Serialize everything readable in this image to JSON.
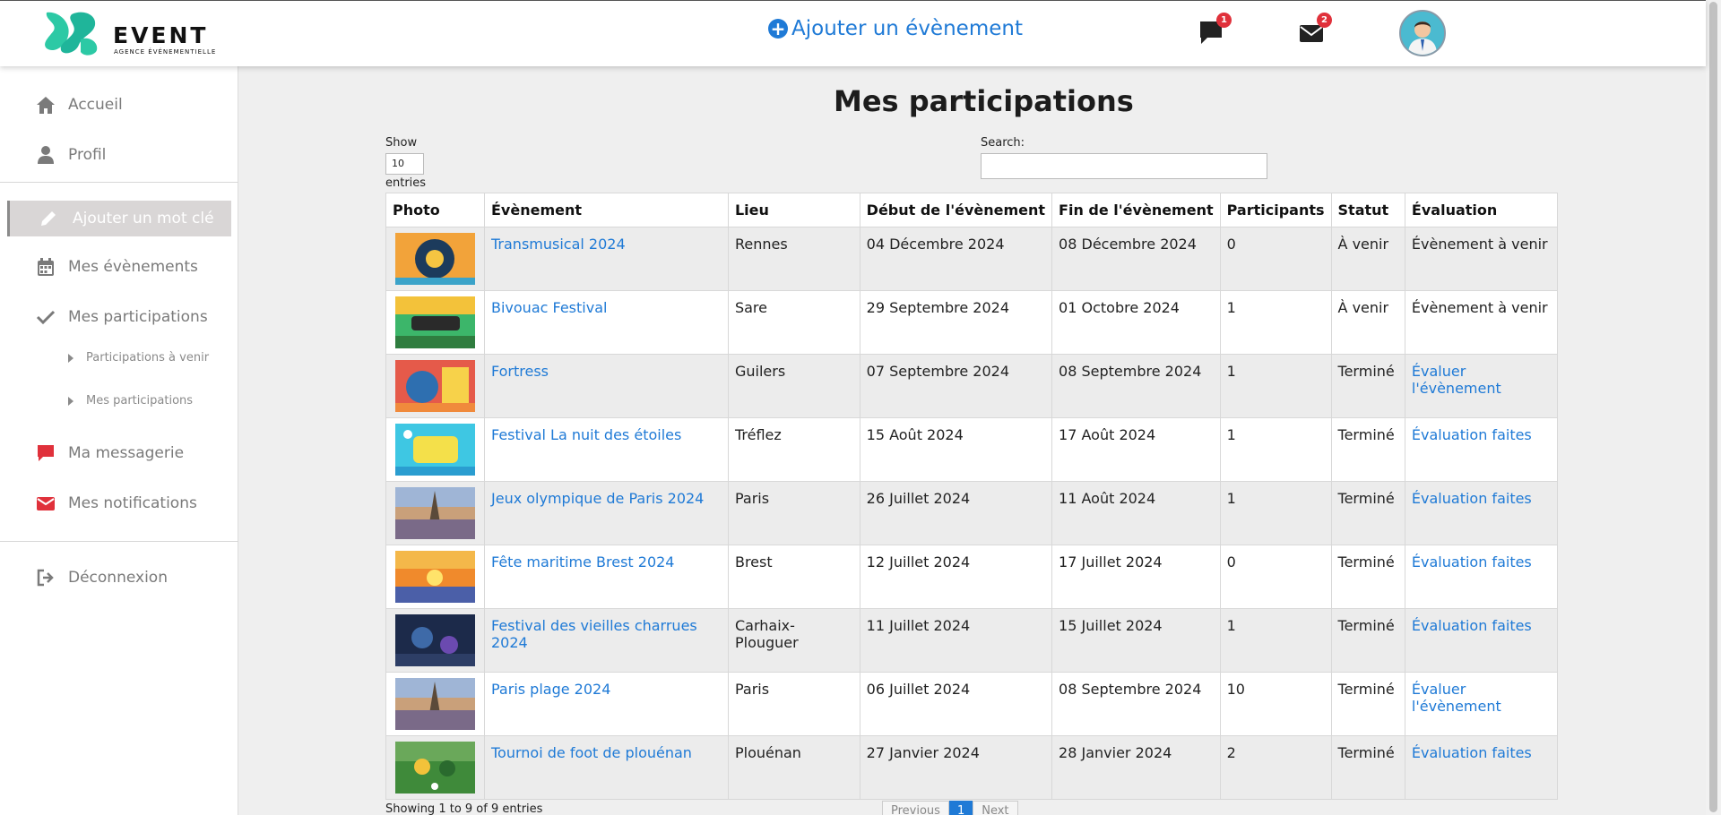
{
  "header": {
    "logo_title": "EVENT",
    "logo_subtitle": "AGENCE ÉVÉNEMENTIELLE",
    "add_event_label": "Ajouter un évènement",
    "chat_badge": "1",
    "mail_badge": "2",
    "colors": {
      "accent": "#1f7ad6",
      "badge": "#e0313b",
      "logo": "#2cc9a5"
    }
  },
  "sidebar": {
    "home": "Accueil",
    "profile": "Profil",
    "add_keyword": "Ajouter un mot clé",
    "my_events": "Mes évènements",
    "my_participations": "Mes participations",
    "sub_upcoming": "Participations à venir",
    "sub_participations": "Mes participations",
    "messaging": "Ma messagerie",
    "notifications": "Mes notifications",
    "logout": "Déconnexion"
  },
  "main": {
    "title": "Mes participations",
    "show_label": "Show",
    "page_length": "10",
    "entries_label": "entries",
    "search_label": "Search:",
    "search_value": "",
    "columns": [
      "Photo",
      "Évènement",
      "Lieu",
      "Début de l'évènement",
      "Fin de l'évènement",
      "Participants",
      "Statut",
      "Évaluation"
    ],
    "rows": [
      {
        "event": "Transmusical 2024",
        "place": "Rennes",
        "start": "04 Décembre 2024",
        "end": "08 Décembre 2024",
        "participants": "0",
        "status": "À venir",
        "evaluation": "Évènement à venir",
        "eval_link": false,
        "thumb": "orange"
      },
      {
        "event": "Bivouac Festival",
        "place": "Sare",
        "start": "29 Septembre 2024",
        "end": "01 Octobre 2024",
        "participants": "1",
        "status": "À venir",
        "evaluation": "Évènement à venir",
        "eval_link": false,
        "thumb": "green"
      },
      {
        "event": "Fortress",
        "place": "Guilers",
        "start": "07 Septembre 2024",
        "end": "08 Septembre 2024",
        "participants": "1",
        "status": "Terminé",
        "evaluation": "Évaluer l'évènement",
        "eval_link": true,
        "thumb": "red"
      },
      {
        "event": "Festival La nuit des étoiles",
        "place": "Tréflez",
        "start": "15 Août 2024",
        "end": "17 Août 2024",
        "participants": "1",
        "status": "Terminé",
        "evaluation": "Évaluation faites",
        "eval_link": true,
        "thumb": "cyan"
      },
      {
        "event": "Jeux olympique de Paris 2024",
        "place": "Paris",
        "start": "26 Juillet 2024",
        "end": "11 Août 2024",
        "participants": "1",
        "status": "Terminé",
        "evaluation": "Évaluation faites",
        "eval_link": true,
        "thumb": "paris"
      },
      {
        "event": "Fête maritime Brest 2024",
        "place": "Brest",
        "start": "12 Juillet 2024",
        "end": "17 Juillet 2024",
        "participants": "0",
        "status": "Terminé",
        "evaluation": "Évaluation faites",
        "eval_link": true,
        "thumb": "sunset"
      },
      {
        "event": "Festival des vieilles charrues 2024",
        "place": "Carhaix-Plouguer",
        "start": "11 Juillet 2024",
        "end": "15 Juillet 2024",
        "participants": "1",
        "status": "Terminé",
        "evaluation": "Évaluation faites",
        "eval_link": true,
        "thumb": "night"
      },
      {
        "event": "Paris plage 2024",
        "place": "Paris",
        "start": "06 Juillet 2024",
        "end": "08 Septembre 2024",
        "participants": "10",
        "status": "Terminé",
        "evaluation": "Évaluer l'évènement",
        "eval_link": true,
        "thumb": "paris"
      },
      {
        "event": "Tournoi de foot de plouénan",
        "place": "Plouénan",
        "start": "27 Janvier 2024",
        "end": "28 Janvier 2024",
        "participants": "2",
        "status": "Terminé",
        "evaluation": "Évaluation faites",
        "eval_link": true,
        "thumb": "football"
      }
    ],
    "info": "Showing 1 to 9 of 9 entries",
    "pager": {
      "previous": "Previous",
      "current": "1",
      "next": "Next"
    }
  }
}
